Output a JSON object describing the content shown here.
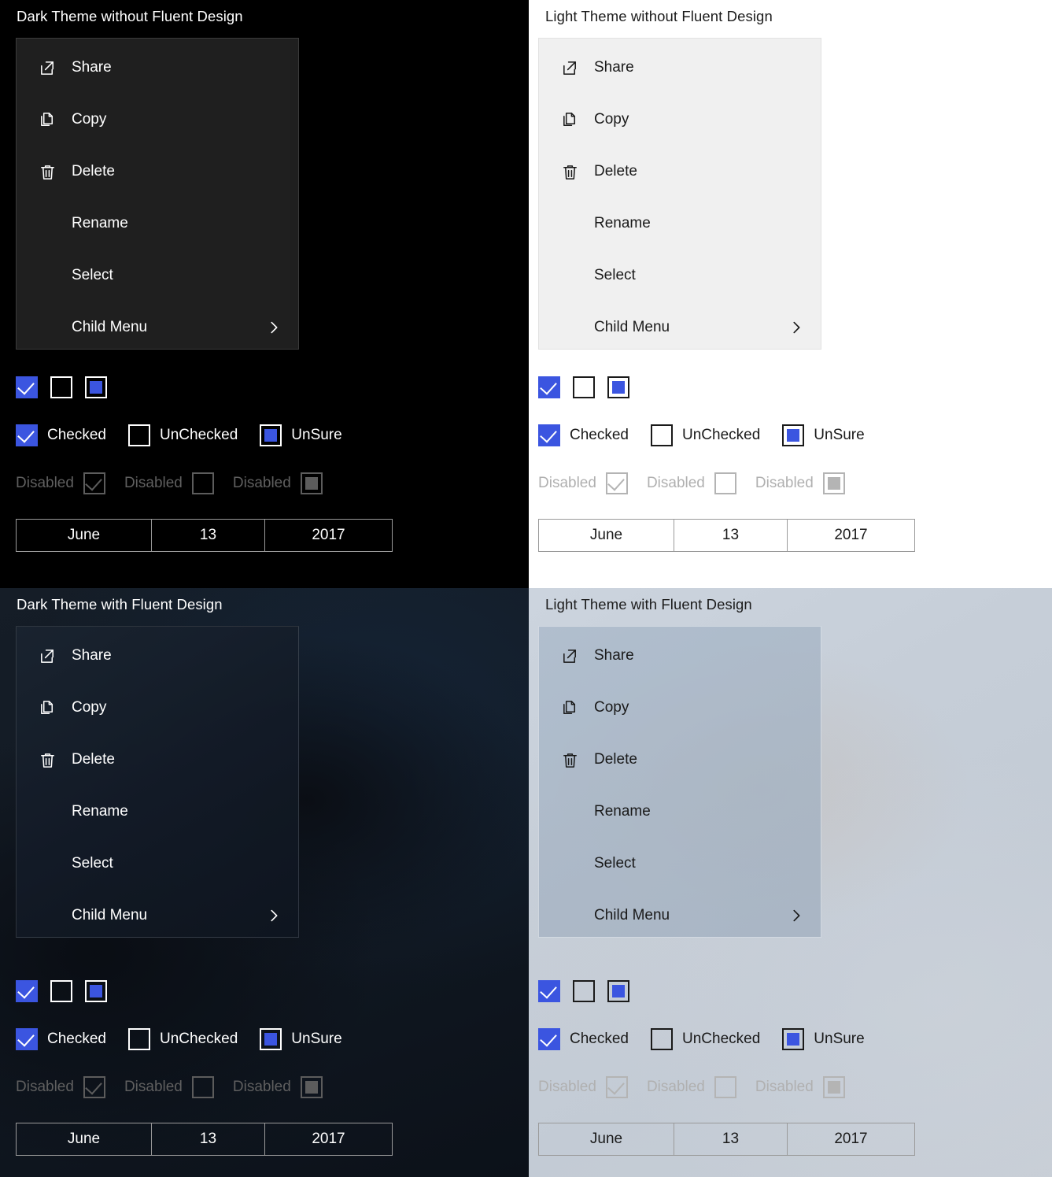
{
  "accent_color": "#3b55e0",
  "panels": [
    {
      "id": "dark-plain",
      "title": "Dark Theme without Fluent Design",
      "menu": {
        "items": [
          {
            "label": "Share",
            "icon": "share-icon",
            "has_submenu": false
          },
          {
            "label": "Copy",
            "icon": "copy-icon",
            "has_submenu": false
          },
          {
            "label": "Delete",
            "icon": "trash-icon",
            "has_submenu": false
          },
          {
            "label": "Rename",
            "icon": null,
            "has_submenu": false
          },
          {
            "label": "Select",
            "icon": null,
            "has_submenu": false
          },
          {
            "label": "Child Menu",
            "icon": null,
            "has_submenu": true
          }
        ]
      },
      "checkboxes": {
        "compact_row": [
          {
            "state": "checked",
            "label": ""
          },
          {
            "state": "unchecked",
            "label": ""
          },
          {
            "state": "unsure",
            "label": ""
          }
        ],
        "labeled_row": [
          {
            "state": "checked",
            "label": "Checked"
          },
          {
            "state": "unchecked",
            "label": "UnChecked"
          },
          {
            "state": "unsure",
            "label": "UnSure"
          }
        ],
        "disabled_row": [
          {
            "state": "checked",
            "label": "Disabled"
          },
          {
            "state": "unchecked",
            "label": "Disabled"
          },
          {
            "state": "unsure",
            "label": "Disabled"
          }
        ]
      },
      "date_picker": {
        "month": "June",
        "day": "13",
        "year": "2017"
      }
    },
    {
      "id": "light-plain",
      "title": "Light Theme without Fluent Design",
      "menu": {
        "items": [
          {
            "label": "Share",
            "icon": "share-icon",
            "has_submenu": false
          },
          {
            "label": "Copy",
            "icon": "copy-icon",
            "has_submenu": false
          },
          {
            "label": "Delete",
            "icon": "trash-icon",
            "has_submenu": false
          },
          {
            "label": "Rename",
            "icon": null,
            "has_submenu": false
          },
          {
            "label": "Select",
            "icon": null,
            "has_submenu": false
          },
          {
            "label": "Child Menu",
            "icon": null,
            "has_submenu": true
          }
        ]
      },
      "checkboxes": {
        "compact_row": [
          {
            "state": "checked",
            "label": ""
          },
          {
            "state": "unchecked",
            "label": ""
          },
          {
            "state": "unsure",
            "label": ""
          }
        ],
        "labeled_row": [
          {
            "state": "checked",
            "label": "Checked"
          },
          {
            "state": "unchecked",
            "label": "UnChecked"
          },
          {
            "state": "unsure",
            "label": "UnSure"
          }
        ],
        "disabled_row": [
          {
            "state": "checked",
            "label": "Disabled"
          },
          {
            "state": "unchecked",
            "label": "Disabled"
          },
          {
            "state": "unsure",
            "label": "Disabled"
          }
        ]
      },
      "date_picker": {
        "month": "June",
        "day": "13",
        "year": "2017"
      }
    },
    {
      "id": "dark-fluent",
      "title": "Dark Theme with Fluent Design",
      "menu": {
        "items": [
          {
            "label": "Share",
            "icon": "share-icon",
            "has_submenu": false
          },
          {
            "label": "Copy",
            "icon": "copy-icon",
            "has_submenu": false
          },
          {
            "label": "Delete",
            "icon": "trash-icon",
            "has_submenu": false
          },
          {
            "label": "Rename",
            "icon": null,
            "has_submenu": false
          },
          {
            "label": "Select",
            "icon": null,
            "has_submenu": false
          },
          {
            "label": "Child Menu",
            "icon": null,
            "has_submenu": true
          }
        ]
      },
      "checkboxes": {
        "compact_row": [
          {
            "state": "checked",
            "label": ""
          },
          {
            "state": "unchecked",
            "label": ""
          },
          {
            "state": "unsure",
            "label": ""
          }
        ],
        "labeled_row": [
          {
            "state": "checked",
            "label": "Checked"
          },
          {
            "state": "unchecked",
            "label": "UnChecked"
          },
          {
            "state": "unsure",
            "label": "UnSure"
          }
        ],
        "disabled_row": [
          {
            "state": "checked",
            "label": "Disabled"
          },
          {
            "state": "unchecked",
            "label": "Disabled"
          },
          {
            "state": "unsure",
            "label": "Disabled"
          }
        ]
      },
      "date_picker": {
        "month": "June",
        "day": "13",
        "year": "2017"
      }
    },
    {
      "id": "light-fluent",
      "title": "Light Theme with Fluent Design",
      "menu": {
        "items": [
          {
            "label": "Share",
            "icon": "share-icon",
            "has_submenu": false
          },
          {
            "label": "Copy",
            "icon": "copy-icon",
            "has_submenu": false
          },
          {
            "label": "Delete",
            "icon": "trash-icon",
            "has_submenu": false
          },
          {
            "label": "Rename",
            "icon": null,
            "has_submenu": false
          },
          {
            "label": "Select",
            "icon": null,
            "has_submenu": false
          },
          {
            "label": "Child Menu",
            "icon": null,
            "has_submenu": true
          }
        ]
      },
      "checkboxes": {
        "compact_row": [
          {
            "state": "checked",
            "label": ""
          },
          {
            "state": "unchecked",
            "label": ""
          },
          {
            "state": "unsure",
            "label": ""
          }
        ],
        "labeled_row": [
          {
            "state": "checked",
            "label": "Checked"
          },
          {
            "state": "unchecked",
            "label": "UnChecked"
          },
          {
            "state": "unsure",
            "label": "UnSure"
          }
        ],
        "disabled_row": [
          {
            "state": "checked",
            "label": "Disabled"
          },
          {
            "state": "unchecked",
            "label": "Disabled"
          },
          {
            "state": "unsure",
            "label": "Disabled"
          }
        ]
      },
      "date_picker": {
        "month": "June",
        "day": "13",
        "year": "2017"
      }
    }
  ]
}
